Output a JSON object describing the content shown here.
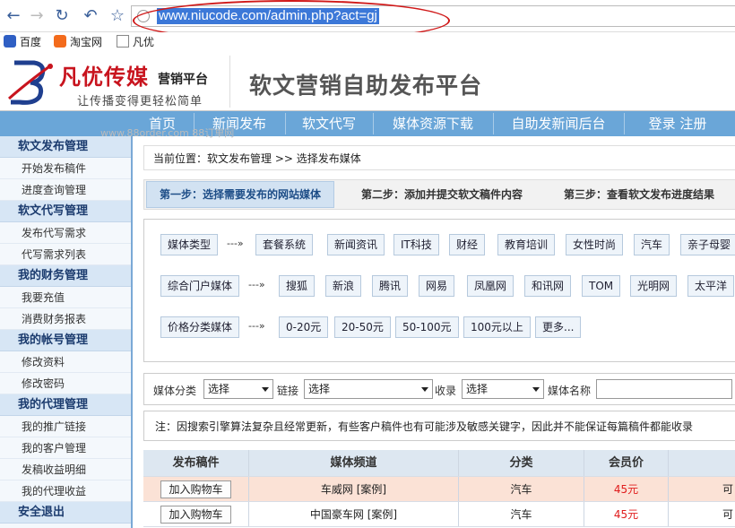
{
  "browser": {
    "url": "www.niucode.com/admin.php?act=gj",
    "bookmarks": [
      "百度",
      "淘宝网",
      "凡优"
    ]
  },
  "header": {
    "logo_name": "凡优传媒",
    "logo_sub": "营销平台",
    "slogan": "让传播变得更轻松简单",
    "platform_title": "软文营销自助发布平台"
  },
  "nav": {
    "items": [
      "首页",
      "新闻发布",
      "软文代写",
      "媒体资源下载",
      "自助发新闻后台",
      "登录 注册"
    ]
  },
  "watermark": "www.88order.com 88订单网",
  "sidebar": {
    "groups": [
      {
        "title": "软文发布管理",
        "items": [
          "开始发布稿件",
          "进度查询管理"
        ]
      },
      {
        "title": "软文代写管理",
        "items": [
          "发布代写需求",
          "代写需求列表"
        ]
      },
      {
        "title": "我的财务管理",
        "items": [
          "我要充值",
          "消费财务报表"
        ]
      },
      {
        "title": "我的帐号管理",
        "items": [
          "修改资料",
          "修改密码"
        ]
      },
      {
        "title": "我的代理管理",
        "items": [
          "我的推广链接",
          "我的客户管理",
          "发稿收益明细",
          "我的代理收益"
        ]
      },
      {
        "title": "安全退出",
        "items": []
      }
    ]
  },
  "breadcrumb": "当前位置：软文发布管理 >> 选择发布媒体",
  "steps": [
    "第一步：选择需要发布的网站媒体",
    "第二步：添加并提交软文稿件内容",
    "第三步：查看软文发布进度结果"
  ],
  "filters": {
    "arrow": "---»",
    "rows": [
      {
        "label": "媒体类型",
        "tags": [
          "套餐系统",
          "新闻资讯",
          "IT科技",
          "财经",
          "教育培训",
          "女性时尚",
          "汽车",
          "亲子母婴"
        ]
      },
      {
        "label": "综合门户媒体",
        "tags": [
          "搜狐",
          "新浪",
          "腾讯",
          "网易",
          "凤凰网",
          "和讯网",
          "TOM",
          "光明网",
          "太平洋"
        ]
      },
      {
        "label": "价格分类媒体",
        "tags": [
          "0-20元",
          "20-50元",
          "50-100元",
          "100元以上",
          "更多..."
        ]
      }
    ]
  },
  "search": {
    "category_label": "媒体分类",
    "category_value": "选择",
    "link_label": "链接",
    "link_value": "选择",
    "index_label": "收录",
    "index_value": "选择",
    "name_label": "媒体名称"
  },
  "notice": "注：因搜索引擎算法复杂且经常更新，有些客户稿件也有可能涉及敏感关键字，因此并不能保证每篇稿件都能收录",
  "table": {
    "headers": [
      "发布稿件",
      "媒体频道",
      "分类",
      "会员价"
    ],
    "rows": [
      {
        "button": "加入购物车",
        "channel": "车威网  [案例]",
        "category": "汽车",
        "price": "45元",
        "extra": "可"
      },
      {
        "button": "加入购物车",
        "channel": "中国豪车网  [案例]",
        "category": "汽车",
        "price": "45元",
        "extra": "可"
      }
    ]
  },
  "colors": {
    "nav": "#6aa6d8",
    "accent_red": "#c8141e",
    "highlight_row": "#fbe2d6"
  }
}
